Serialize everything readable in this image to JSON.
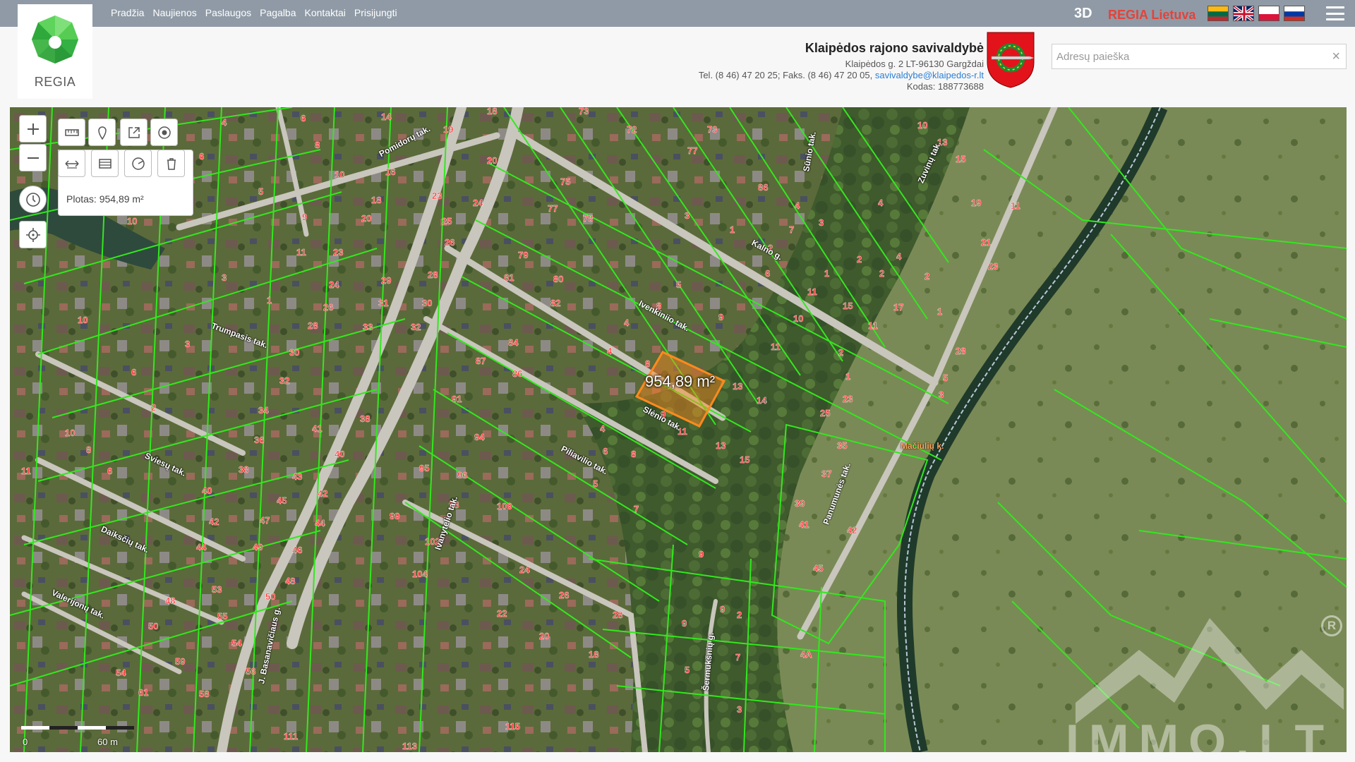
{
  "nav": {
    "items": [
      {
        "label": "Pradžia"
      },
      {
        "label": "Naujienos"
      },
      {
        "label": "Paslaugos"
      },
      {
        "label": "Pagalba"
      },
      {
        "label": "Kontaktai"
      },
      {
        "label": "Prisijungti"
      }
    ],
    "three_d": "3D",
    "regia_lietuva": "REGIA Lietuva",
    "languages": [
      "lt-flag-icon",
      "en-flag-icon",
      "pl-flag-icon",
      "ru-flag-icon"
    ]
  },
  "logo": {
    "text": "REGIA",
    "icon": "regia-logo-icon",
    "color": "#5cc85a"
  },
  "municipality": {
    "title": "Klaipėdos rajono savivaldybė",
    "address": "Klaipėdos g. 2 LT-96130 Gargždai",
    "phone_line": "Tel. (8 46) 47 20 25; Faks. (8 46) 47 20 05,",
    "email": "savivaldybe@klaipedos-r.lt",
    "code": "Kodas: 188773688",
    "coat_of_arms": "coat-of-arms-icon"
  },
  "search": {
    "placeholder": "Adresų paieška",
    "value": "",
    "clear": "×"
  },
  "map": {
    "measure_result": "Plotas: 954,89 m²",
    "area_label": "954,89 m²",
    "scale_zero": "0",
    "scale_label": "60 m",
    "place_label": "Mačiulių k.",
    "parcel_line_color": "#32e81e",
    "selected_parcel_color": "#ff8a1e",
    "number_color": "#ff2a2a",
    "roads": [
      {
        "name": "Pomidorų tak."
      },
      {
        "name": "Trumpasis tak."
      },
      {
        "name": "Sviesų tak."
      },
      {
        "name": "Daiksčių tak."
      },
      {
        "name": "Valerijonų tak."
      },
      {
        "name": "Ivenkiniio tak."
      },
      {
        "name": "Slėnio tak."
      },
      {
        "name": "Piliavilio tak."
      },
      {
        "name": "Kalno g."
      },
      {
        "name": "Sūnio tak."
      },
      {
        "name": "Zuvinų tak."
      },
      {
        "name": "Panumunės tak."
      },
      {
        "name": "J. Basanavičiaus g."
      },
      {
        "name": "Ivanytelio tak."
      },
      {
        "name": "Šermukšnių g."
      }
    ],
    "tools": [
      "zoom-in-icon",
      "zoom-out-icon",
      "measure-length-icon",
      "marker-icon",
      "share-icon",
      "target-icon",
      "measure-distance-icon",
      "measure-area-icon",
      "measure-radius-icon",
      "delete-icon",
      "history-clock-icon",
      "locate-icon"
    ]
  },
  "watermark": {
    "text": "IMMO.LT",
    "registered": "R"
  }
}
